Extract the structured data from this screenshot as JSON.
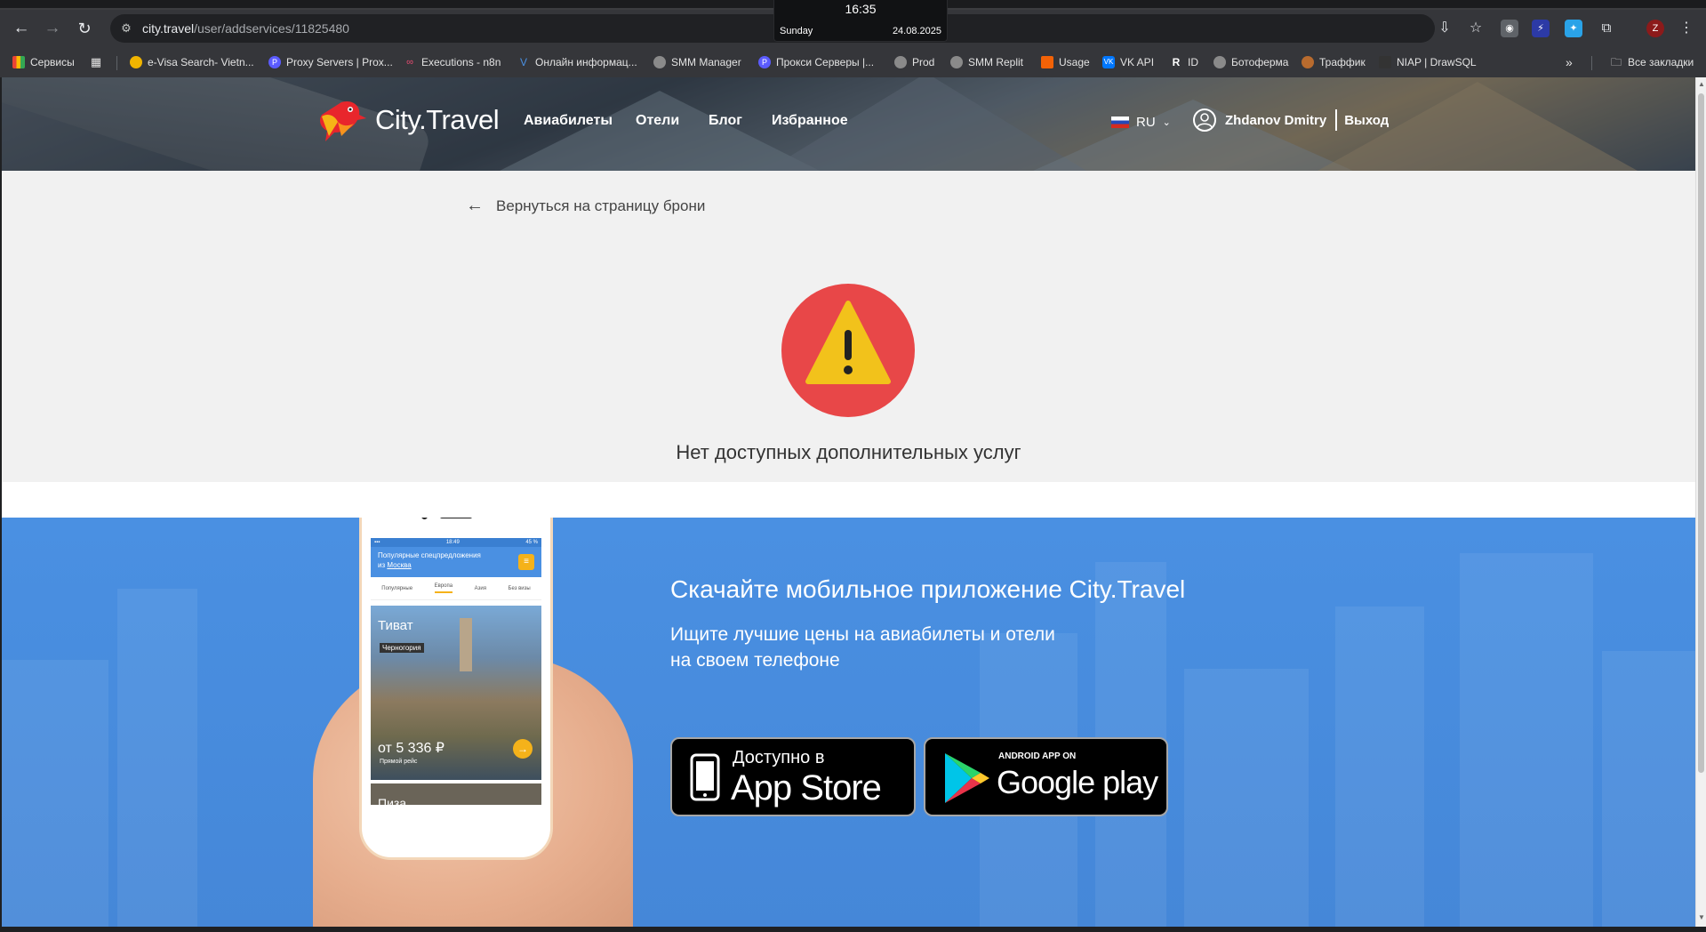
{
  "browser": {
    "url_host": "city.travel",
    "url_path": "/user/addservices/11825480",
    "clock": {
      "time": "16:35",
      "day": "Sunday",
      "date": "24.08.2025"
    },
    "bookmarks": [
      {
        "label": "Сервисы",
        "icon": "apps-grid-icon",
        "color": "#e37400"
      },
      {
        "label": "e-Visa Search- Vietn...",
        "icon": "globe-icon",
        "color": "#f0b400"
      },
      {
        "label": "Proxy Servers | Prox...",
        "icon": "proxy-icon",
        "color": "#5b5bff"
      },
      {
        "label": "Executions - n8n",
        "icon": "n8n-icon",
        "color": "#ea4b71"
      },
      {
        "label": "Онлайн информац...",
        "icon": "v-icon",
        "color": "#4a90e2"
      },
      {
        "label": "SMM Manager",
        "icon": "globe-icon",
        "color": "#8a8a8a"
      },
      {
        "label": "Прокси Серверы |...",
        "icon": "proxy-icon",
        "color": "#5b5bff"
      },
      {
        "label": "Prod",
        "icon": "globe-icon",
        "color": "#8a8a8a"
      },
      {
        "label": "SMM Replit",
        "icon": "globe-icon",
        "color": "#8a8a8a"
      },
      {
        "label": "Usage",
        "icon": "replit-icon",
        "color": "#f26207"
      },
      {
        "label": "VK API",
        "icon": "vk-icon",
        "color": "#0077ff"
      },
      {
        "label": "ID",
        "icon": "r-icon",
        "color": "#444444"
      },
      {
        "label": "Ботоферма",
        "icon": "globe-icon",
        "color": "#8a8a8a"
      },
      {
        "label": "Траффик",
        "icon": "traffic-icon",
        "color": "#b86b2e"
      },
      {
        "label": "NIAP | DrawSQL",
        "icon": "drawsql-icon",
        "color": "#333333"
      }
    ],
    "all_bookmarks": "Все закладки"
  },
  "site": {
    "logo_text": "City.Travel",
    "nav": [
      "Авиабилеты",
      "Отели",
      "Блог",
      "Избранное"
    ],
    "lang": "RU",
    "user_name": "Zhdanov Dmitry",
    "logout": "Выход",
    "back_link": "Вернуться на страницу брони",
    "message": "Нет доступных дополнительных услуг",
    "promo": {
      "title": "Скачайте мобильное приложение City.Travel",
      "subtitle_line1": "Ищите лучшие цены на авиабилеты и отели",
      "subtitle_line2": "на своем телефоне",
      "appstore_small": "Доступно в",
      "appstore_big": "App Store",
      "gplay_small": "ANDROID APP ON",
      "gplay_big": "Google play"
    },
    "phone": {
      "status_time": "18:49",
      "status_battery": "45 %",
      "header_line1": "Популярные спецпредложения",
      "header_line2": "из",
      "header_city": "Москва",
      "tabs": [
        "Популярные",
        "Европа",
        "Азия",
        "Без визы"
      ],
      "card_title": "Тиват",
      "card_country": "Черногория",
      "card_price": "от 5 336 ₽",
      "card_note": "Прямой рейс",
      "next_card": "Пиза"
    }
  }
}
